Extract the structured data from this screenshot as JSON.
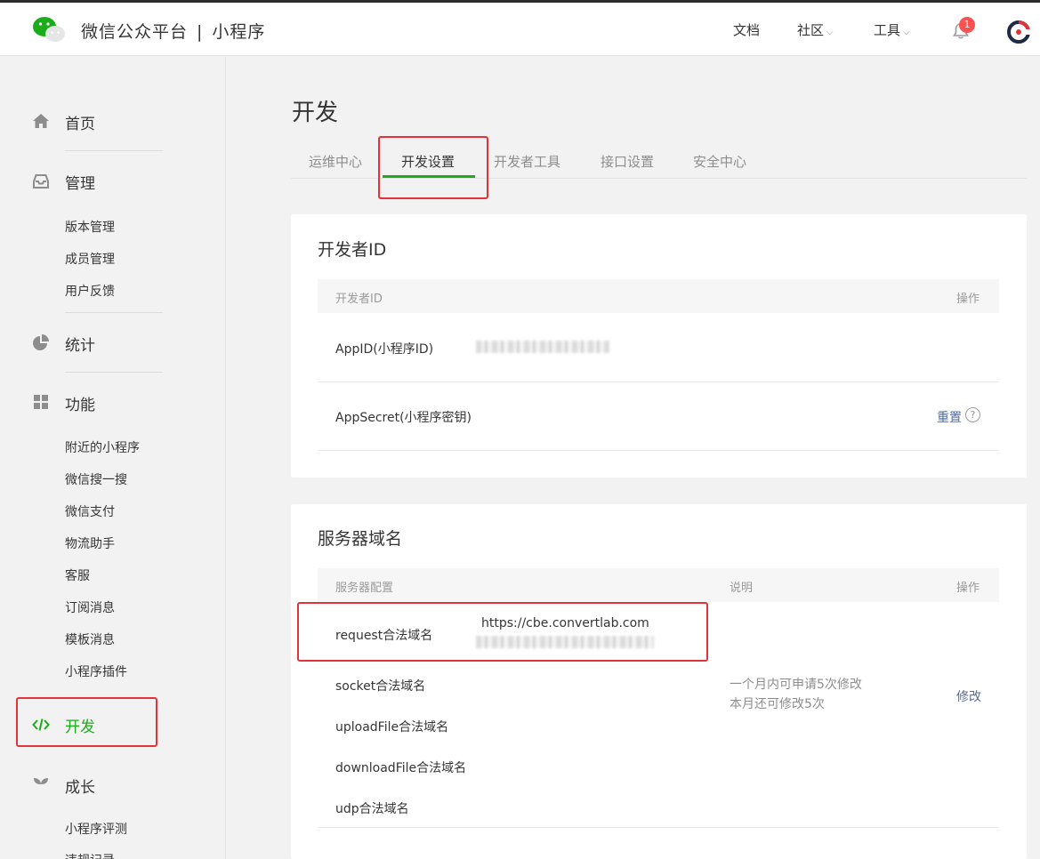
{
  "header": {
    "brand_name": "微信公众平台",
    "brand_separator": "|",
    "brand_product": "小程序",
    "nav": {
      "docs": "文档",
      "community": "社区",
      "tools": "工具"
    },
    "notification_count": "1"
  },
  "sidebar": {
    "home": "首页",
    "manage": "管理",
    "manage_items": [
      "版本管理",
      "成员管理",
      "用户反馈"
    ],
    "stats": "统计",
    "features": "功能",
    "feature_items": [
      "附近的小程序",
      "微信搜一搜",
      "微信支付",
      "物流助手",
      "客服",
      "订阅消息",
      "模板消息",
      "小程序插件"
    ],
    "develop": "开发",
    "growth": "成长",
    "growth_items": [
      "小程序评测",
      "违规记录"
    ]
  },
  "main": {
    "title": "开发",
    "tabs": [
      "运维中心",
      "开发设置",
      "开发者工具",
      "接口设置",
      "安全中心"
    ],
    "active_tab": "开发设置"
  },
  "developer_id": {
    "title": "开发者ID",
    "col_id": "开发者ID",
    "col_action": "操作",
    "appid_label": "AppID(小程序ID)",
    "appsecret_label": "AppSecret(小程序密钥)",
    "reset_link": "重置",
    "help_icon": "?"
  },
  "server_domain": {
    "title": "服务器域名",
    "col_config": "服务器配置",
    "col_desc": "说明",
    "col_action": "操作",
    "rows": {
      "request": "request合法域名",
      "socket": "socket合法域名",
      "upload": "uploadFile合法域名",
      "download": "downloadFile合法域名",
      "udp": "udp合法域名"
    },
    "request_value": "https://cbe.convertlab.com",
    "note_line1": "一个月内可申请5次修改",
    "note_line2": "本月还可修改5次",
    "modify_link": "修改"
  },
  "colors": {
    "accent_green": "#1aad19",
    "highlight_red": "#e0343a",
    "link_blue": "#576b95",
    "badge_red": "#fa5151"
  }
}
